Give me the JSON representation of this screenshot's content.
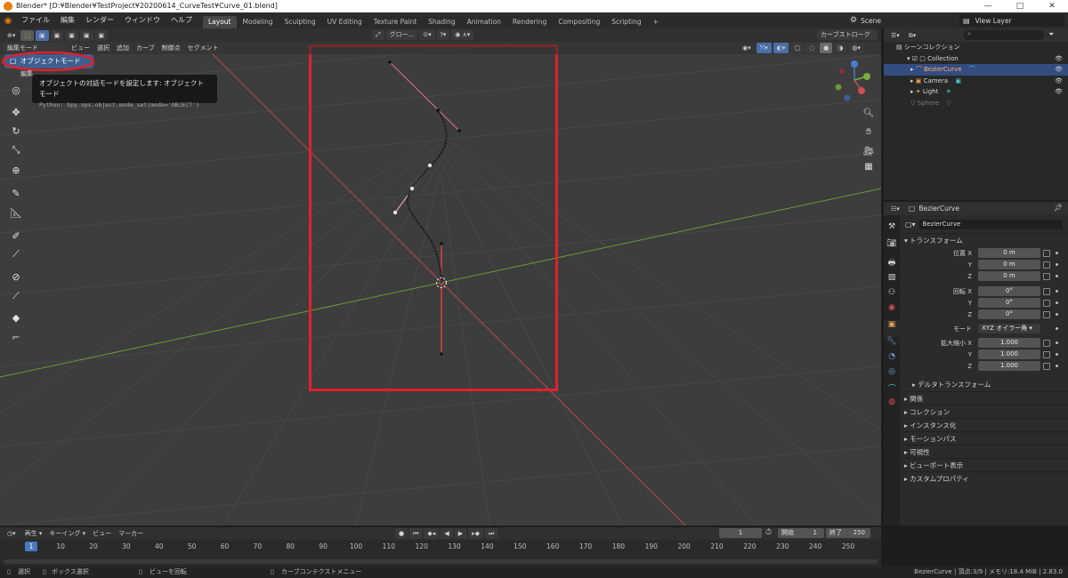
{
  "window": {
    "title": "Blender* [D:¥Blender¥TestProject¥20200614_CurveTest¥Curve_01.blend]",
    "controls": [
      "—",
      "□",
      "✕"
    ]
  },
  "topbar": {
    "menus": [
      "ファイル",
      "編集",
      "レンダー",
      "ウィンドウ",
      "ヘルプ"
    ],
    "workspaces": [
      "Layout",
      "Modeling",
      "Sculpting",
      "UV Editing",
      "Texture Paint",
      "Shading",
      "Animation",
      "Rendering",
      "Compositing",
      "Scripting",
      "+"
    ],
    "active_workspace": "Layout",
    "scene": "Scene",
    "view_layer": "View Layer"
  },
  "viewport": {
    "header_menus": [
      "編集モード",
      "ビュー",
      "選択",
      "追加",
      "カーブ",
      "制御点",
      "セグメント"
    ],
    "orientation": "グロー...",
    "stroke_dropdown": "カーブストローク",
    "mode_dropdown": {
      "selected": "オブジェクトモード",
      "second_item": "編集"
    },
    "tooltip": {
      "line1": "オブジェクトの対話モードを設定します: オブジェクトモード",
      "line2": "Python: bpy.ops.object.mode_set(mode='OBJECT')"
    },
    "highlight_color": "#e0212b",
    "axis_colors": {
      "x": "#e06060",
      "y": "#7ab03a"
    }
  },
  "outliner": {
    "root": "シーンコレクション",
    "items": [
      {
        "label": "Collection",
        "selected": false
      },
      {
        "label": "BezierCurve",
        "selected": true
      },
      {
        "label": "Camera",
        "selected": false
      },
      {
        "label": "Light",
        "selected": false
      },
      {
        "label": "Sphere",
        "selected": false
      }
    ]
  },
  "properties": {
    "object_header": "BezierCurve",
    "object_name": "BezierCurve",
    "transform_title": "トランスフォーム",
    "location": {
      "label": "位置",
      "x": "0 m",
      "y": "0 m",
      "z": "0 m"
    },
    "rotation": {
      "label": "回転",
      "x": "0°",
      "y": "0°",
      "z": "0°"
    },
    "mode_label": "モード",
    "mode_value": "XYZ オイラー角",
    "scale": {
      "label": "拡大縮小",
      "x": "1.000",
      "y": "1.000",
      "z": "1.000"
    },
    "axes": [
      "X",
      "Y",
      "Z"
    ],
    "delta": "デルタトランスフォーム",
    "sections": [
      "関係",
      "コレクション",
      "インスタンス化",
      "モーションパス",
      "可視性",
      "ビューポート表示",
      "カスタムプロパティ"
    ]
  },
  "timeline": {
    "menus": [
      "再生",
      "キーイング",
      "ビュー",
      "マーカー"
    ],
    "current_frame": "1",
    "start_label": "開始",
    "start": "1",
    "end_label": "終了",
    "end": "250",
    "ticks": [
      "1",
      "10",
      "20",
      "30",
      "40",
      "50",
      "60",
      "70",
      "80",
      "90",
      "100",
      "110",
      "120",
      "130",
      "140",
      "150",
      "160",
      "170",
      "180",
      "190",
      "200",
      "210",
      "220",
      "230",
      "240",
      "250"
    ]
  },
  "status": {
    "select": "選択",
    "box_select": "ボックス選択",
    "rotate_view": "ビューを回転",
    "context_menu": "カーブコンテクストメニュー",
    "info": "BezierCurve | 頂点:3/9 | メモリ:18.4 MiB | 2.83.0"
  }
}
